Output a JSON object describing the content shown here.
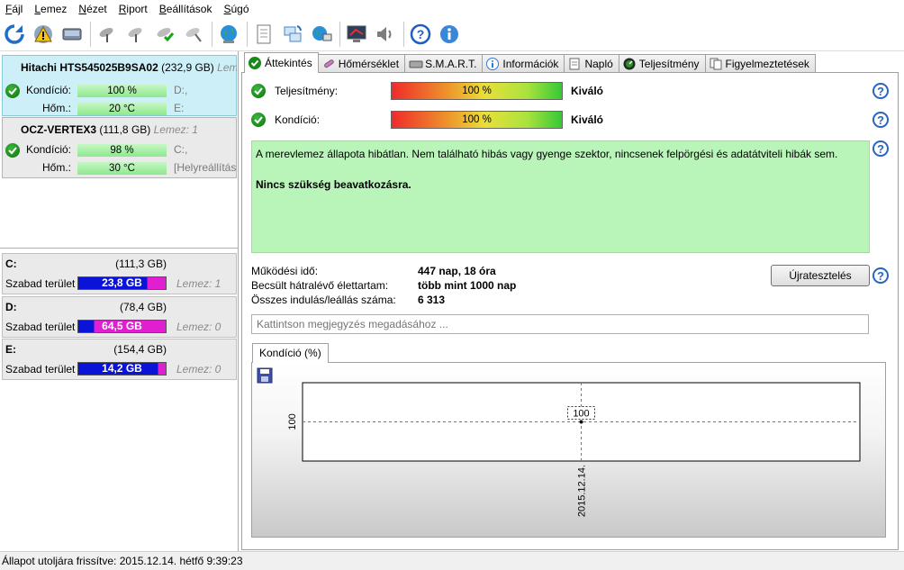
{
  "menu": {
    "items": [
      {
        "ul": "F",
        "rest": "ájl"
      },
      {
        "ul": "L",
        "rest": "emez"
      },
      {
        "ul": "N",
        "rest": "ézet"
      },
      {
        "ul": "R",
        "rest": "iport"
      },
      {
        "ul": "B",
        "rest": "eállítások"
      },
      {
        "ul": "S",
        "rest": "úgó"
      }
    ]
  },
  "toolbar": {
    "icons": [
      "refresh-icon",
      "warning-icon",
      "disk-icon",
      "satellite-gray-icon",
      "satellite-gray2-icon",
      "satellite-green-icon",
      "satellite-tool-icon",
      "globe-icon",
      "document-icon",
      "sync-icon",
      "network-icon",
      "monitor-icon",
      "speaker-icon",
      "help-icon",
      "info-icon"
    ]
  },
  "disks": [
    {
      "name": "Hitachi HTS545025B9SA02",
      "size": "(232,9 GB)",
      "extra": "Leme",
      "condition_label": "Kondíció:",
      "condition_value": "100 %",
      "temp_label": "Hőm.:",
      "temp_value": "20 °C",
      "vol1": "D:,",
      "vol2": "E:"
    },
    {
      "name": "OCZ-VERTEX3",
      "size": "(111,8 GB)",
      "extra": "Lemez: 1",
      "condition_label": "Kondíció:",
      "condition_value": "98 %",
      "temp_label": "Hőm.:",
      "temp_value": "30 °C",
      "vol1": "C:,",
      "vol2": "[Helyreállítás"
    }
  ],
  "partitions": [
    {
      "letter": "C:",
      "total": "(111,3 GB)",
      "free_label": "Szabad terület",
      "free": "23,8 GB",
      "disk": "Lemez: 1",
      "free_fraction": 0.79,
      "free_color": "#e020d0"
    },
    {
      "letter": "D:",
      "total": "(78,4 GB)",
      "free_label": "Szabad terület",
      "free": "64,5 GB",
      "disk": "Lemez: 0",
      "free_fraction": 0.18,
      "free_color": "#e020d0"
    },
    {
      "letter": "E:",
      "total": "(154,4 GB)",
      "free_label": "Szabad terület",
      "free": "14,2 GB",
      "disk": "Lemez: 0",
      "free_fraction": 0.91,
      "free_color": "#e020d0"
    }
  ],
  "tabs": [
    {
      "label": "Áttekintés",
      "icon": "check-icon"
    },
    {
      "label": "Hőmérséklet",
      "icon": "thermometer-icon"
    },
    {
      "label": "S.M.A.R.T.",
      "icon": "disk-icon"
    },
    {
      "label": "Információk",
      "icon": "info-icon"
    },
    {
      "label": "Napló",
      "icon": "log-icon"
    },
    {
      "label": "Teljesítmény",
      "icon": "gauge-icon"
    },
    {
      "label": "Figyelmeztetések",
      "icon": "alerts-icon"
    }
  ],
  "overview": {
    "performance_label": "Teljesítmény:",
    "performance_value": "100 %",
    "performance_rating": "Kiváló",
    "condition_label": "Kondíció:",
    "condition_value": "100 %",
    "condition_rating": "Kiváló",
    "message": "A merevlemez állapota hibátlan. Nem található hibás vagy gyenge szektor, nincsenek felpörgési és adatátviteli hibák sem.",
    "message_bold": "Nincs szükség beavatkozásra.",
    "uptime_label": "Működési idő:",
    "uptime_value": "447 nap, 18 óra",
    "life_label": "Becsült hátralévő élettartam:",
    "life_value": "több mint 1000 nap",
    "starts_label": "Összes indulás/leállás száma:",
    "starts_value": "6 313",
    "retest_label": "Újratesztelés",
    "note_placeholder": "Kattintson megjegyzés megadásához ..."
  },
  "chart_tab_label": "Kondíció  (%)",
  "chart_data": {
    "type": "line",
    "x": [
      "2015.12.14."
    ],
    "series": [
      {
        "values": [
          100
        ]
      }
    ],
    "data_labels": [
      "100"
    ],
    "ylabel": "100",
    "xlabel": "2015.12.14."
  },
  "status": {
    "text": "Állapot utoljára frissítve: 2015.12.14. hétfő 9:39:23"
  }
}
